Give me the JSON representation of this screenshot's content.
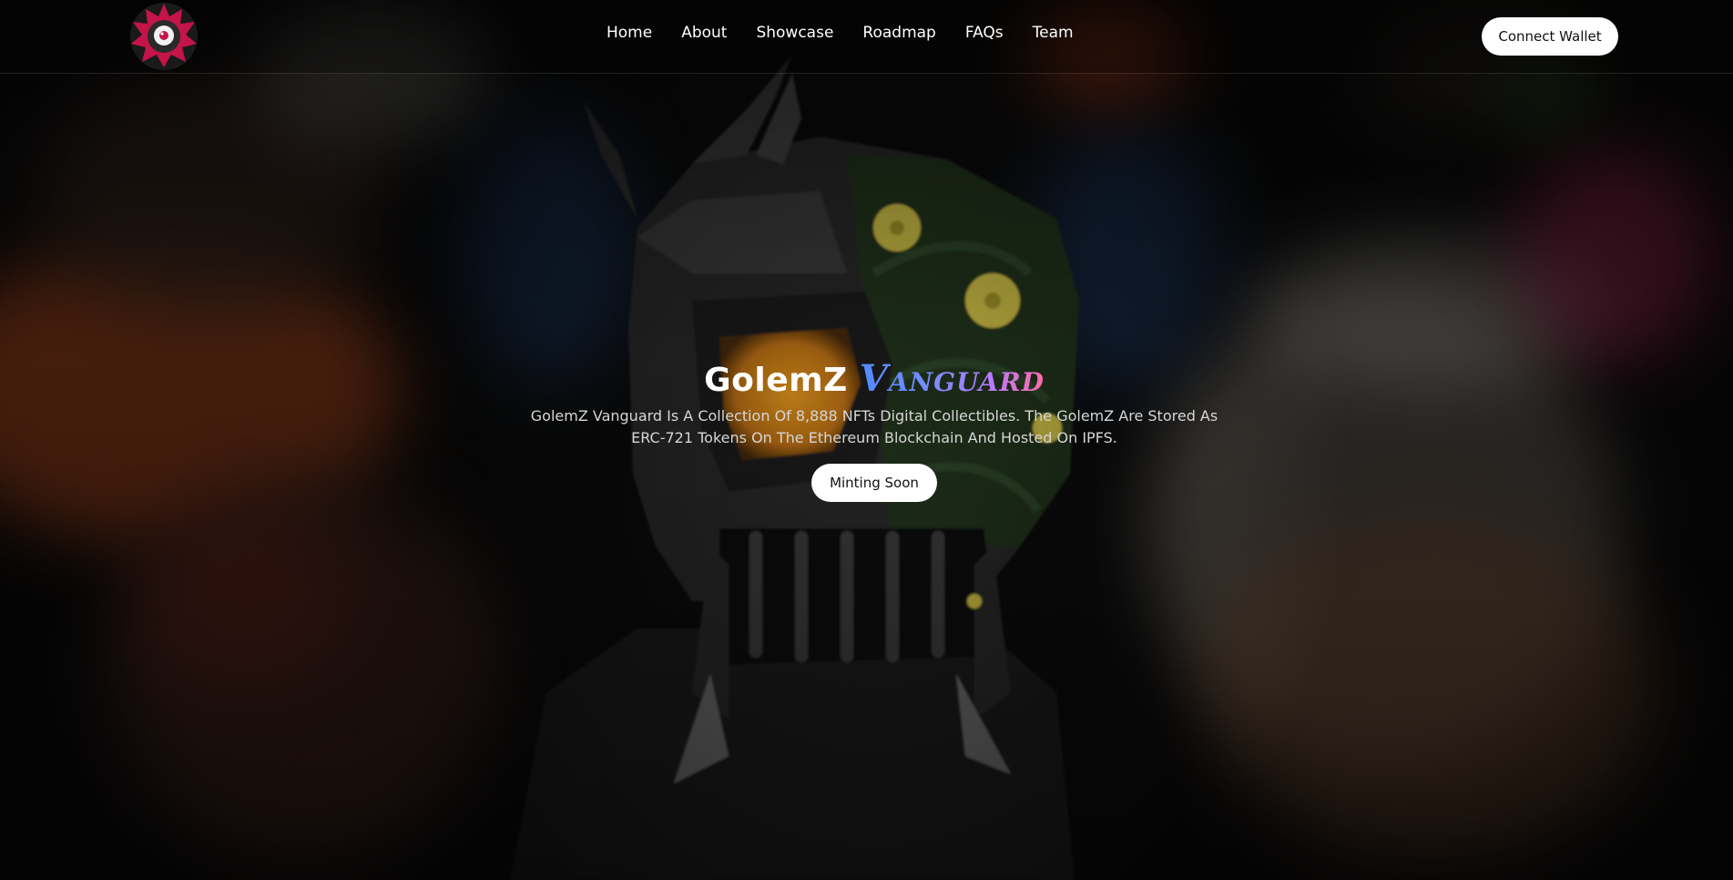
{
  "header": {
    "logo_icon": "golem-logo-icon",
    "nav": [
      {
        "label": "Home"
      },
      {
        "label": "About"
      },
      {
        "label": "Showcase"
      },
      {
        "label": "Roadmap"
      },
      {
        "label": "FAQs"
      },
      {
        "label": "Team"
      }
    ],
    "connect_label": "Connect Wallet"
  },
  "hero": {
    "title_main": "GolemZ",
    "title_accent": "Vanguard",
    "description": "GolemZ Vanguard Is A Collection Of 8,888 NFTs Digital Collectibles. The GolemZ Are Stored As ERC-721 Tokens On The Ethereum Blockchain And Hosted On IPFS.",
    "cta_label": "Minting Soon"
  },
  "colors": {
    "background": "#0b0b0b",
    "button_bg": "#ffffff",
    "button_text": "#111111",
    "logo_accent": "#c4144a",
    "title_gradient": [
      "#4f8bff",
      "#b57cff",
      "#ff6aa8"
    ]
  }
}
